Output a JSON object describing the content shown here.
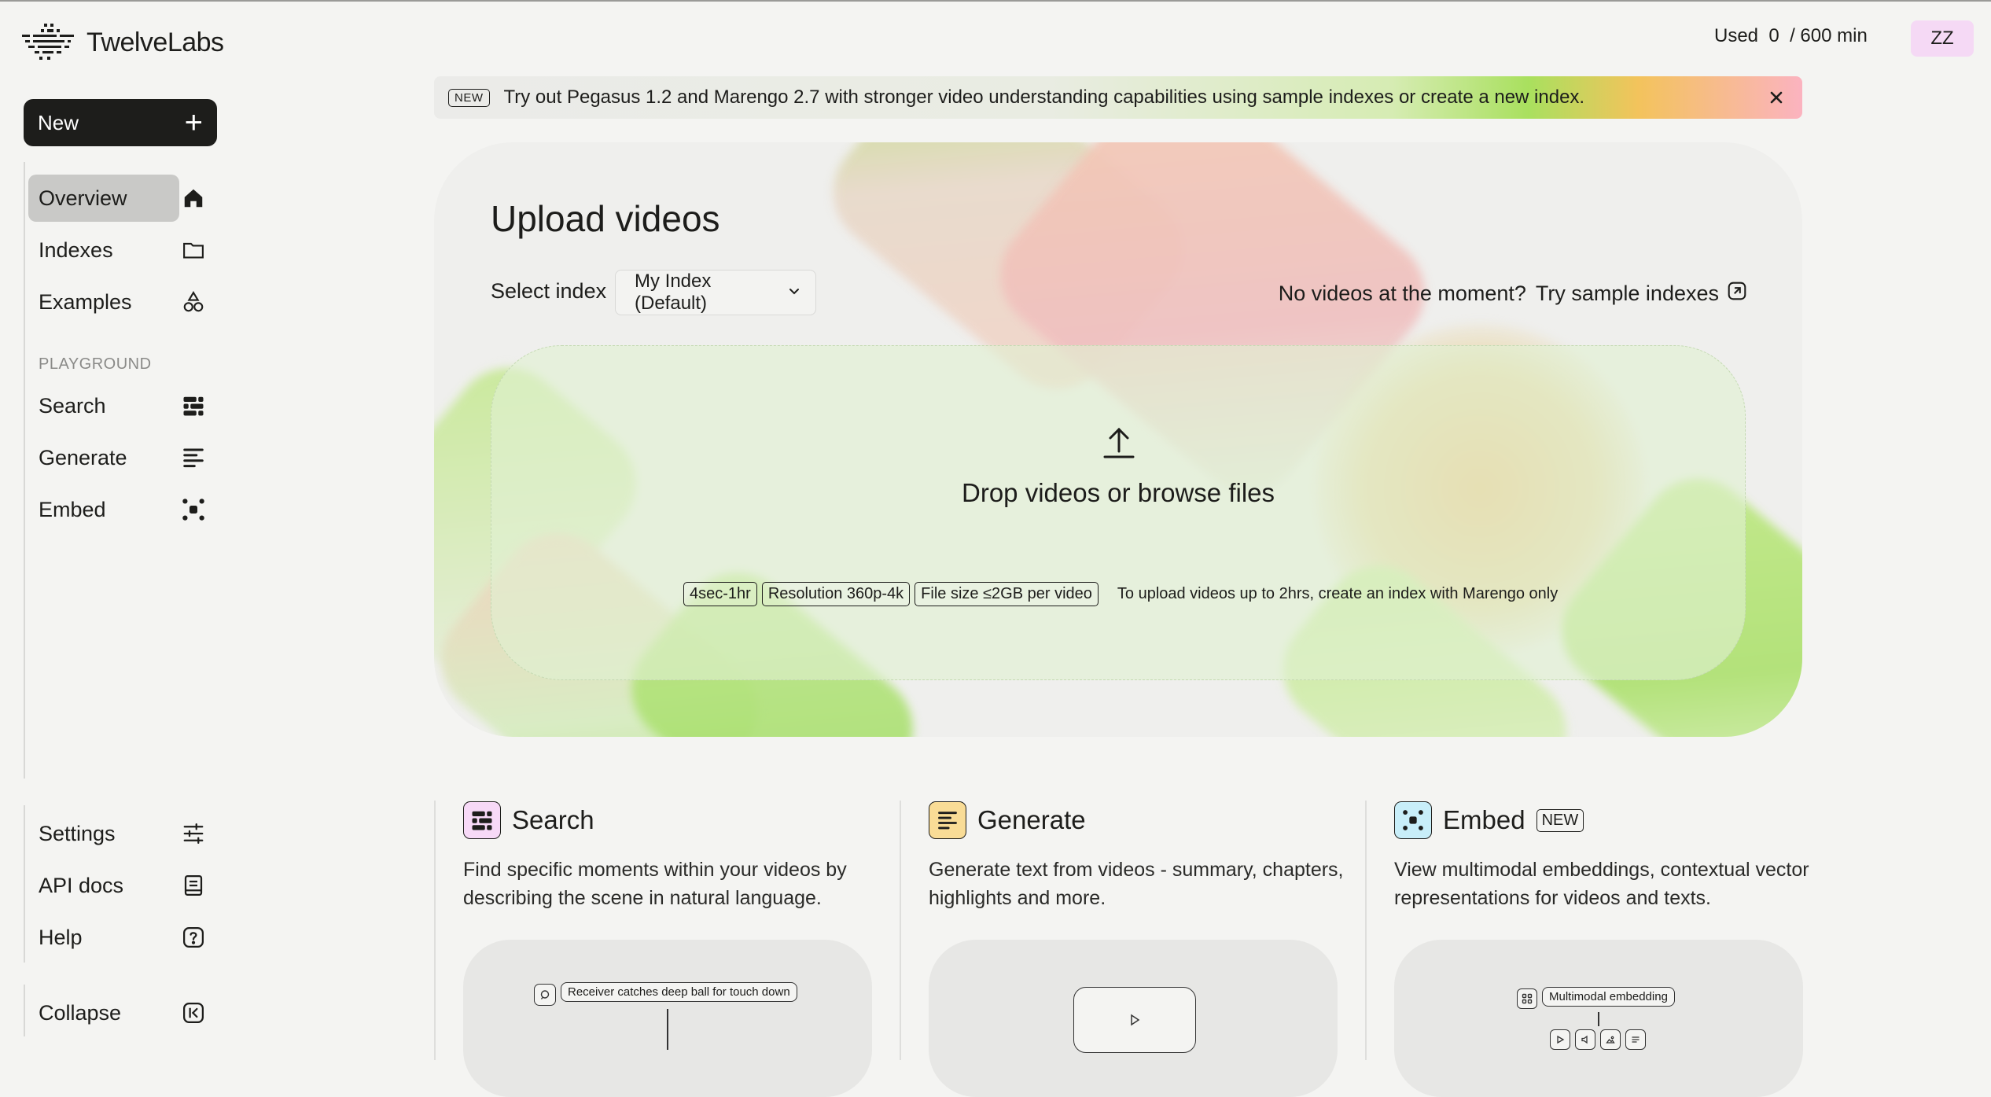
{
  "app": {
    "logo_text": "TwelveLabs"
  },
  "header": {
    "usage_prefix": "Used",
    "usage_used": "0",
    "usage_total": "/ 600 min",
    "avatar_initials": "ZZ"
  },
  "sidebar": {
    "new_label": "New",
    "main_items": [
      {
        "label": "Overview",
        "icon": "home-icon"
      },
      {
        "label": "Indexes",
        "icon": "folder-icon"
      },
      {
        "label": "Examples",
        "icon": "shapes-icon"
      }
    ],
    "section_label": "PLAYGROUND",
    "playground_items": [
      {
        "label": "Search",
        "icon": "search-blocks-icon"
      },
      {
        "label": "Generate",
        "icon": "generate-lines-icon"
      },
      {
        "label": "Embed",
        "icon": "embed-nodes-icon"
      }
    ],
    "bottom_items": [
      {
        "label": "Settings",
        "icon": "sliders-icon"
      },
      {
        "label": "API docs",
        "icon": "book-icon"
      },
      {
        "label": "Help",
        "icon": "help-icon"
      }
    ],
    "collapse_label": "Collapse"
  },
  "banner": {
    "badge": "NEW",
    "text": "Try out Pegasus 1.2 and Marengo 2.7 with stronger video understanding capabilities using sample indexes or create a new index."
  },
  "upload": {
    "title": "Upload videos",
    "select_label": "Select index",
    "selected_index": "My Index (Default)",
    "sample_prompt": "No videos at the moment?",
    "sample_link": "Try sample indexes",
    "drop_text": "Drop videos or browse files",
    "chips": [
      "4sec-1hr",
      "Resolution 360p-4k",
      "File size ≤2GB per video"
    ],
    "note": "To upload videos up to 2hrs, create an index with Marengo only"
  },
  "features": [
    {
      "title": "Search",
      "desc": "Find specific moments within your videos by describing the scene in natural language.",
      "preview_text": "Receiver catches deep ball for touch down",
      "color": "#f7d9f7"
    },
    {
      "title": "Generate",
      "desc": "Generate text from videos - summary, chapters, highlights and more.",
      "color": "#f9dc96"
    },
    {
      "title": "Embed",
      "badge": "NEW",
      "desc": "View multimodal embeddings, contextual vector representations for videos and texts.",
      "preview_text": "Multimodal embedding",
      "color": "#c8eef9"
    }
  ]
}
